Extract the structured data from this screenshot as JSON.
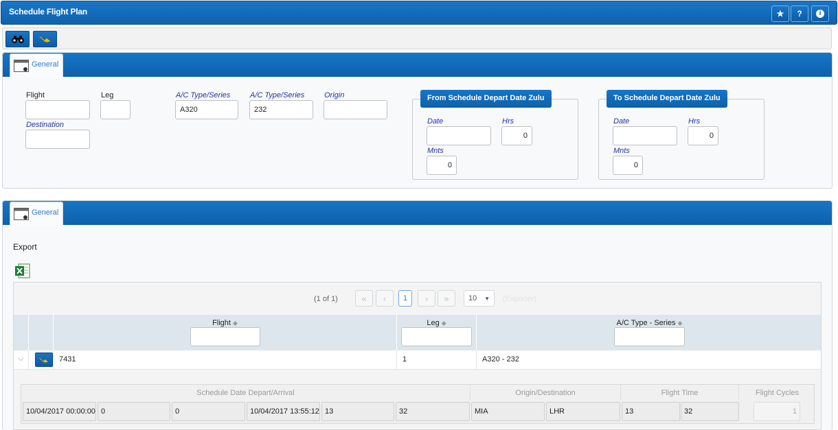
{
  "app": {
    "title": "Schedule Flight Plan",
    "title_buttons": {
      "favorite": "★",
      "help": "?",
      "info": "i"
    }
  },
  "filter_tab": {
    "label": "General"
  },
  "filters": {
    "flight": {
      "label": "Flight",
      "value": ""
    },
    "leg": {
      "label": "Leg",
      "value": ""
    },
    "ac_type_1": {
      "label": "A/C Type/Series",
      "value": "A320"
    },
    "ac_type_2": {
      "label": "A/C Type/Series",
      "value": "232"
    },
    "origin": {
      "label": "Origin",
      "value": ""
    },
    "destination": {
      "label": "Destination",
      "value": ""
    }
  },
  "from_group": {
    "title": "From Schedule Depart Date Zulu",
    "date_label": "Date",
    "date_value": "",
    "hrs_label": "Hrs",
    "hrs_value": "0",
    "mnts_label": "Mnts",
    "mnts_value": "0"
  },
  "to_group": {
    "title": "To Schedule Depart Date Zulu",
    "date_label": "Date",
    "date_value": "",
    "hrs_label": "Hrs",
    "hrs_value": "0",
    "mnts_label": "Mnts",
    "mnts_value": "0"
  },
  "results_tab": {
    "label": "General"
  },
  "export": {
    "label": "Export",
    "icon": "excel-icon"
  },
  "pager": {
    "info": "(1 of 1)",
    "current_page": "1",
    "page_size": "10",
    "exporter_label": "(Exporter)"
  },
  "grid": {
    "columns": [
      "Flight",
      "Leg",
      "A/C Type - Series"
    ],
    "rows": [
      {
        "flight": "7431",
        "leg": "1",
        "ac_type": "A320 - 232"
      }
    ]
  },
  "detail": {
    "headers": [
      "Schedule Date Depart/Arrival",
      "Origin/Destination",
      "Flight Time",
      "Flight Cycles"
    ],
    "values": [
      "10/04/2017 00:00:00",
      "0",
      "0",
      "10/04/2017 13:55:12",
      "13",
      "32",
      "MIA",
      "LHR",
      "13",
      "32",
      "1"
    ]
  },
  "colors": {
    "header_blue": "#0e62ad",
    "link_blue": "#2233aa"
  }
}
